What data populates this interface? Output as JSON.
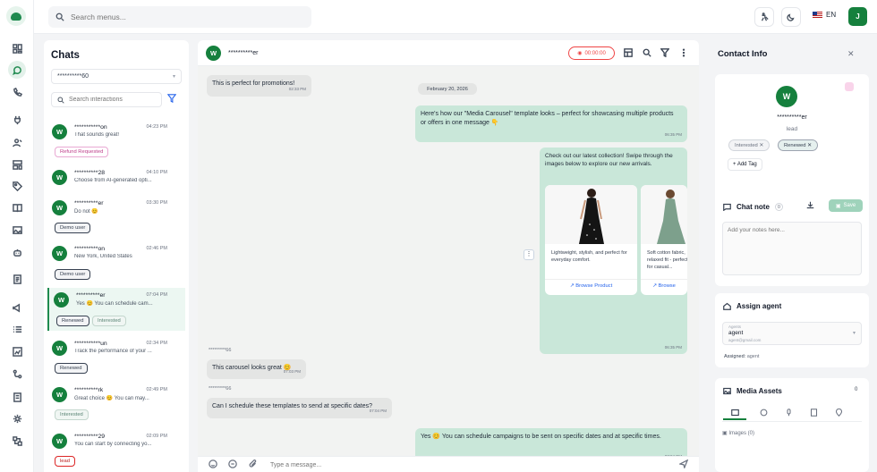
{
  "topbar": {
    "search_placeholder": "Search menus...",
    "language": "EN",
    "user_initial": "J"
  },
  "chats": {
    "title": "Chats",
    "selector_value": "**********60",
    "search_placeholder": "Search interactions",
    "items": [
      {
        "initial": "W",
        "name": "***********on",
        "time": "04:23 PM",
        "msg": "That sounds great!",
        "tag": "Refund Requested"
      },
      {
        "initial": "W",
        "name": "**********28",
        "time": "04:10 PM",
        "msg": "Choose from AI-generated opti...",
        "tag": ""
      },
      {
        "initial": "W",
        "name": "**********er",
        "time": "03:30 PM",
        "msg": "Do not 😊",
        "tag": "Demo user"
      },
      {
        "initial": "W",
        "name": "**********on",
        "time": "02:46 PM",
        "msg": "New York, United States",
        "tag": "Demo user"
      },
      {
        "initial": "W",
        "name": "**********er",
        "time": "07:04 PM",
        "msg": "Yes 😊 You can schedule cam...",
        "tags": [
          "Renewed",
          "Interested"
        ]
      },
      {
        "initial": "W",
        "name": "***********un",
        "time": "02:34 PM",
        "msg": "Track the performance of your ...",
        "tag": "Renewed"
      },
      {
        "initial": "W",
        "name": "**********rk",
        "time": "02:49 PM",
        "msg": "Great choice 😊 You can may...",
        "tag": "Interested"
      },
      {
        "initial": "W",
        "name": "**********29",
        "time": "02:09 PM",
        "msg": "You can start by connecting yo...",
        "tag": "lead"
      }
    ]
  },
  "conversation": {
    "contact_initial": "W",
    "contact_name": "**********er",
    "timer": "00:00:00",
    "date_divider": "February 20, 2026",
    "messages": {
      "m1": {
        "text": "This is perfect for promotions!",
        "time": "02:33 PM"
      },
      "m2": {
        "text": "Here's how our \"Media Carousel\" template looks – perfect for showcasing multiple products or offers in one message 👇",
        "time": "06:35 PM"
      },
      "m3": {
        "text": "Check out our latest collection! Swipe through the images below to explore our new arrivals.",
        "time": "06:35 PM"
      },
      "m4_sender": "*********66",
      "m4": {
        "text": "This carousel looks great 😊",
        "time": "07:03 PM"
      },
      "m5_sender": "*********66",
      "m5": {
        "text": "Can I schedule these templates to send at specific dates?",
        "time": "07:04 PM"
      },
      "m6": {
        "text": "Yes 😊 You can schedule campaigns to be sent on specific dates and at specific times.",
        "time": "07:04 PM"
      }
    },
    "cards": [
      {
        "text": "Lightweight, stylish, and perfect for everyday comfort.",
        "button": "Browse Product"
      },
      {
        "text": "Soft cotton fabric, relaxed fit - perfect for casual...",
        "button": "Browse"
      }
    ],
    "input_placeholder": "Type a message..."
  },
  "contact": {
    "title": "Contact Info",
    "initial": "W",
    "name": "**********er",
    "role": "lead",
    "tags": [
      "Interested",
      "Renewed"
    ],
    "add_tag": "+ Add Tag",
    "note_title": "Chat note",
    "note_count": "0",
    "note_save": "Save",
    "note_placeholder": "Add your notes here...",
    "assign_title": "Assign agent",
    "agent_label": "Agents",
    "agent_name": "agent",
    "agent_email": "agent@gmail.com",
    "assigned_label": "Assigned:",
    "assigned_value": "agent",
    "media_title": "Media Assets",
    "media_count": "0",
    "images_label": "Images (0)"
  },
  "colors": {
    "brand": "#15803d",
    "bubble_out": "#c9e7d9",
    "bubble_in": "#e4e5e4",
    "record": "#ef4444"
  }
}
